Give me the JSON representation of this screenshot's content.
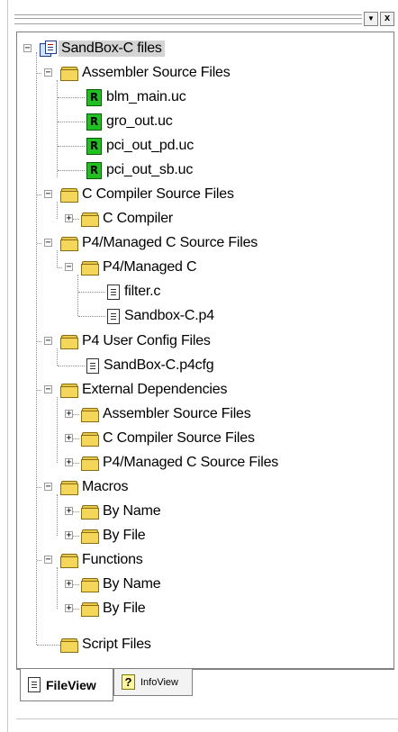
{
  "window": {
    "dropdown_glyph": "▼",
    "close_glyph": "x"
  },
  "tree": {
    "root": "SandBox-C files",
    "asm_group": "Assembler Source Files",
    "asm_files": [
      "blm_main.uc",
      "gro_out.uc",
      "pci_out_pd.uc",
      "pci_out_sb.uc"
    ],
    "asm_icon_letter": "R",
    "cc_group": "C Compiler Source Files",
    "cc_folder": "C Compiler",
    "p4_group": "P4/Managed C Source Files",
    "p4_folder": "P4/Managed C",
    "p4_files": [
      "filter.c",
      "Sandbox-C.p4"
    ],
    "cfg_group": "P4 User Config Files",
    "cfg_file": "SandBox-C.p4cfg",
    "ext_group": "External Dependencies",
    "ext_items": [
      "Assembler Source Files",
      "C Compiler Source Files",
      "P4/Managed C Source Files"
    ],
    "macros_group": "Macros",
    "macros_items": [
      "By Name",
      "By File"
    ],
    "functions_group": "Functions",
    "functions_items": [
      "By Name",
      "By File"
    ],
    "script_group": "Script Files",
    "expand_glyph": "+",
    "collapse_glyph": "−"
  },
  "tabs": {
    "fileview": "FileView",
    "infoview": "InfoView",
    "info_icon_glyph": "?"
  }
}
